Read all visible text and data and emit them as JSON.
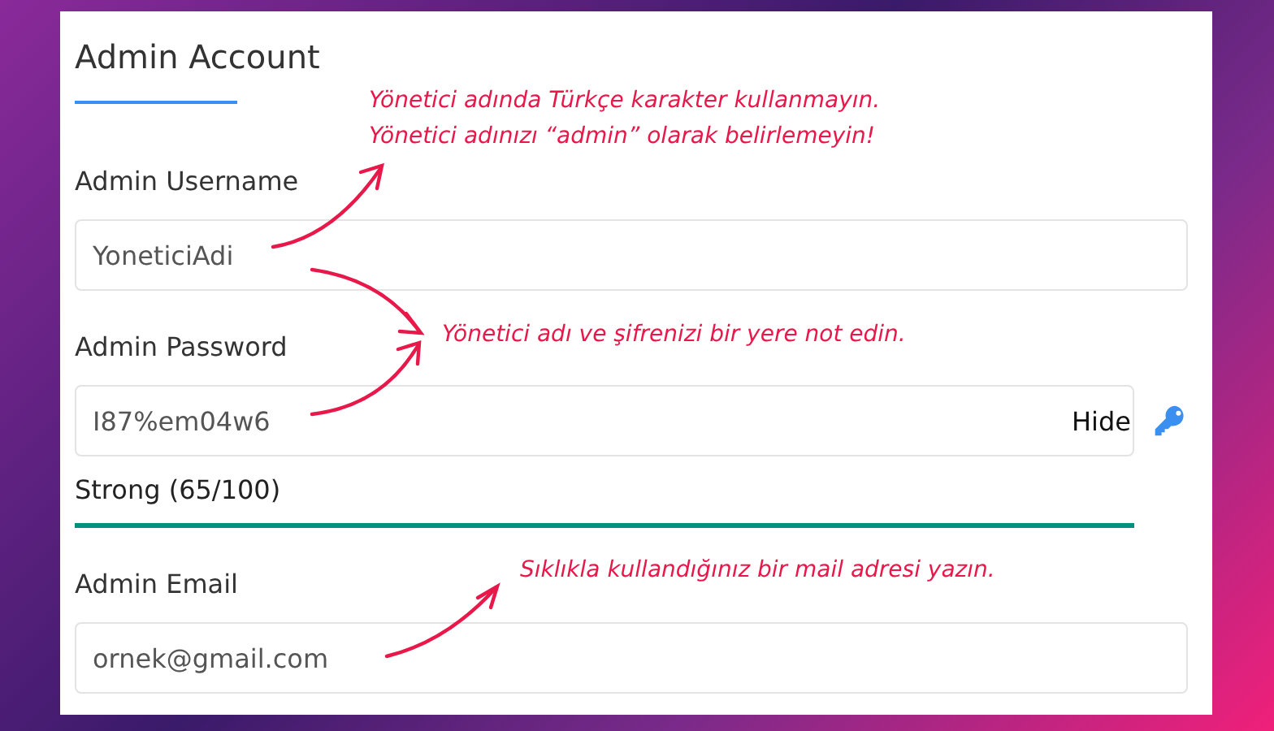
{
  "panel": {
    "title": "Admin Account"
  },
  "fields": [
    {
      "kind": "text",
      "label": "Admin Username",
      "value": "YoneticiAdi"
    },
    {
      "kind": "password",
      "label": "Admin Password",
      "value": "I87%em04w6",
      "toggle": "Hide",
      "strength": "Strong (65/100)"
    },
    {
      "kind": "text",
      "label": "Admin Email",
      "value": "ornek@gmail.com"
    }
  ],
  "annotations": [
    {
      "lines": [
        "Yönetici adında Türkçe karakter kullanmayın.",
        "Yönetici adınızı “admin” olarak belirlemeyin!"
      ]
    },
    {
      "lines": [
        "Yönetici adı ve şifrenizi bir yere not edin."
      ]
    },
    {
      "lines": [
        "Sıklıkla kullandığınız bir mail adresi yazın."
      ]
    }
  ]
}
